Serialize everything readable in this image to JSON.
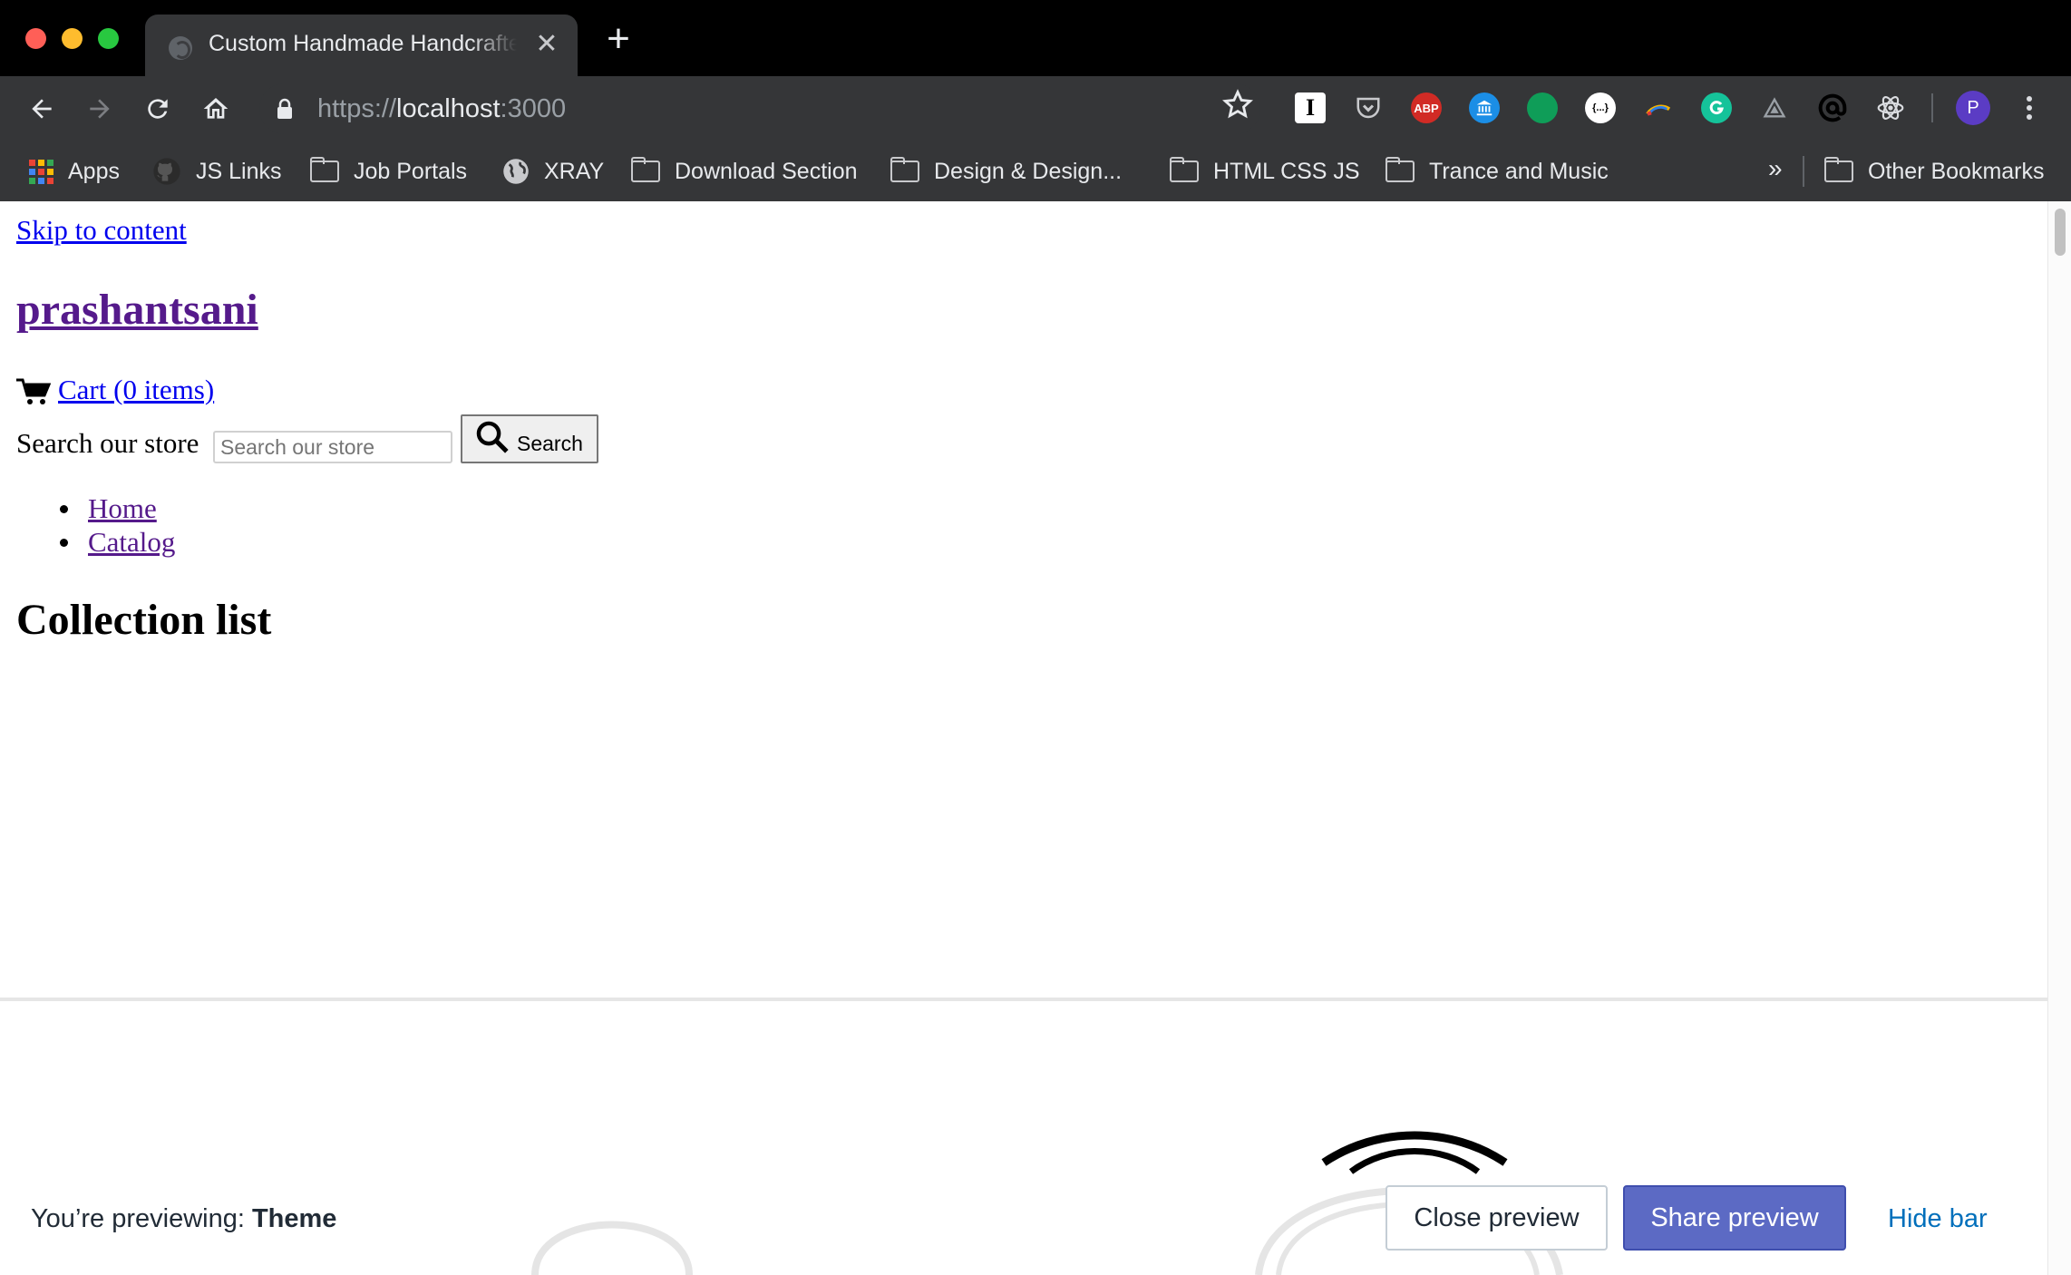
{
  "browser": {
    "tab_title": "Custom Handmade Handcrafted",
    "new_tab_symbol": "+",
    "close_tab_symbol": "✕",
    "url_scheme": "https://",
    "url_host": "localhost",
    "url_port": ":3000",
    "profile_initial": "P",
    "extensions": [
      "instapaper-icon",
      "pocket-icon",
      "adblock-plus-icon",
      "museum-icon",
      "hangouts-icon",
      "json-viewer-icon",
      "colorzilla-icon",
      "grammarly-icon",
      "vercel-icon",
      "at-sign-icon",
      "react-devtools-icon"
    ],
    "ext_abp_label": "ABP",
    "ext_instapaper_label": "I",
    "ext_json_label": "{...}",
    "bookmarks": [
      {
        "label": "Apps",
        "icon": "apps-grid-icon"
      },
      {
        "label": "JS Links",
        "icon": "github-icon"
      },
      {
        "label": "Job Portals",
        "icon": "folder-icon"
      },
      {
        "label": "XRAY",
        "icon": "globe-icon"
      },
      {
        "label": "Download Section",
        "icon": "folder-icon"
      },
      {
        "label": "Design & Design...",
        "icon": "folder-icon"
      },
      {
        "label": "HTML CSS JS",
        "icon": "folder-icon"
      },
      {
        "label": "Trance and Music",
        "icon": "folder-icon"
      }
    ],
    "bookmarks_overflow": "»",
    "other_bookmarks": "Other Bookmarks"
  },
  "page": {
    "skip_link": "Skip to content",
    "site_title": "prashantsani",
    "cart_link": "Cart (0 items)",
    "search_label": "Search our store",
    "search_placeholder": "Search our store",
    "search_button": "Search",
    "nav": [
      {
        "label": "Home"
      },
      {
        "label": "Catalog"
      }
    ],
    "collection_heading": "Collection list"
  },
  "preview_bar": {
    "prefix": "You’re previewing: ",
    "theme_name": "Theme",
    "close_button": "Close preview",
    "share_button": "Share preview",
    "hide_link": "Hide bar"
  },
  "colors": {
    "share_button_bg": "#5c6ac4",
    "hide_link": "#006fbb",
    "visited_link": "#551a8b",
    "unvisited_link": "#0000ee"
  }
}
